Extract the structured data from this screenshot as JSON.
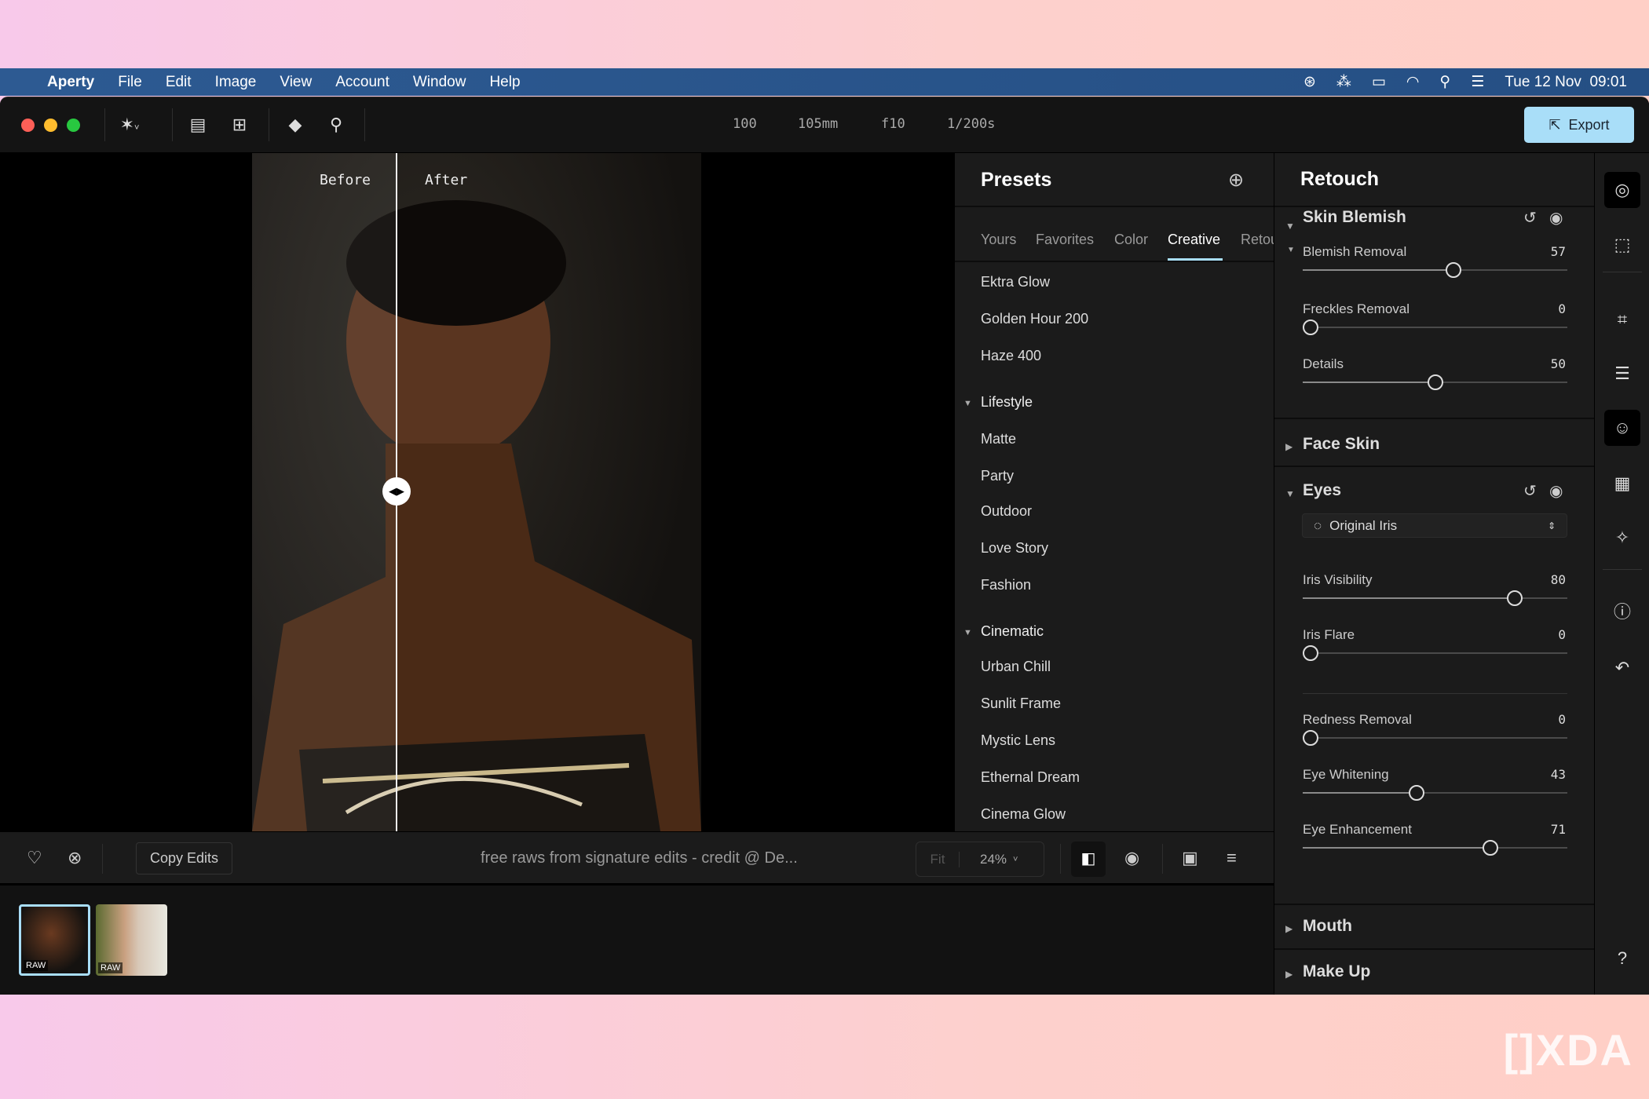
{
  "menubar": {
    "app": "Aperty",
    "items": [
      "File",
      "Edit",
      "Image",
      "View",
      "Account",
      "Window",
      "Help"
    ],
    "datetime": "Tue 12 Nov  09:01"
  },
  "toolbar": {
    "iso": "100",
    "focal": "105mm",
    "aperture": "f10",
    "shutter": "1/200s",
    "export_label": "Export"
  },
  "canvas": {
    "before_label": "Before",
    "after_label": "After"
  },
  "presets": {
    "title": "Presets",
    "tabs": [
      "Yours",
      "Favorites",
      "Color",
      "Creative",
      "Retou"
    ],
    "active_tab": "Creative",
    "items": [
      "Ektra Glow",
      "Golden Hour 200",
      "Haze 400"
    ],
    "groups": [
      {
        "name": "Lifestyle",
        "items": [
          "Matte",
          "Party",
          "Outdoor",
          "Love Story",
          "Fashion"
        ]
      },
      {
        "name": "Cinematic",
        "items": [
          "Urban Chill",
          "Sunlit Frame",
          "Mystic Lens",
          "Ethernal Dream",
          "Cinema Glow"
        ]
      }
    ]
  },
  "retouch": {
    "title": "Retouch",
    "skin_blemish": {
      "title": "Skin Blemish",
      "sliders": [
        {
          "label": "Blemish Removal",
          "value": 57
        },
        {
          "label": "Freckles Removal",
          "value": 0
        },
        {
          "label": "Details",
          "value": 50
        }
      ]
    },
    "face_skin": {
      "title": "Face Skin"
    },
    "eyes": {
      "title": "Eyes",
      "iris_select": "Original Iris",
      "sliders": [
        {
          "label": "Iris Visibility",
          "value": 80
        },
        {
          "label": "Iris Flare",
          "value": 0
        },
        {
          "label": "Redness Removal",
          "value": 0
        },
        {
          "label": "Eye Whitening",
          "value": 43
        },
        {
          "label": "Eye Enhancement",
          "value": 71
        }
      ]
    },
    "mouth": {
      "title": "Mouth"
    },
    "makeup": {
      "title": "Make Up"
    }
  },
  "bottombar": {
    "copy_edits": "Copy Edits",
    "filename": "free raws from signature edits - credit @ De...",
    "fit": "Fit",
    "zoom": "24%"
  },
  "filmstrip": {
    "badges": [
      "RAW",
      "RAW"
    ]
  },
  "colors": {
    "accent": "#a9def8",
    "menubar": "#2d5a92"
  },
  "watermark": "XDA"
}
